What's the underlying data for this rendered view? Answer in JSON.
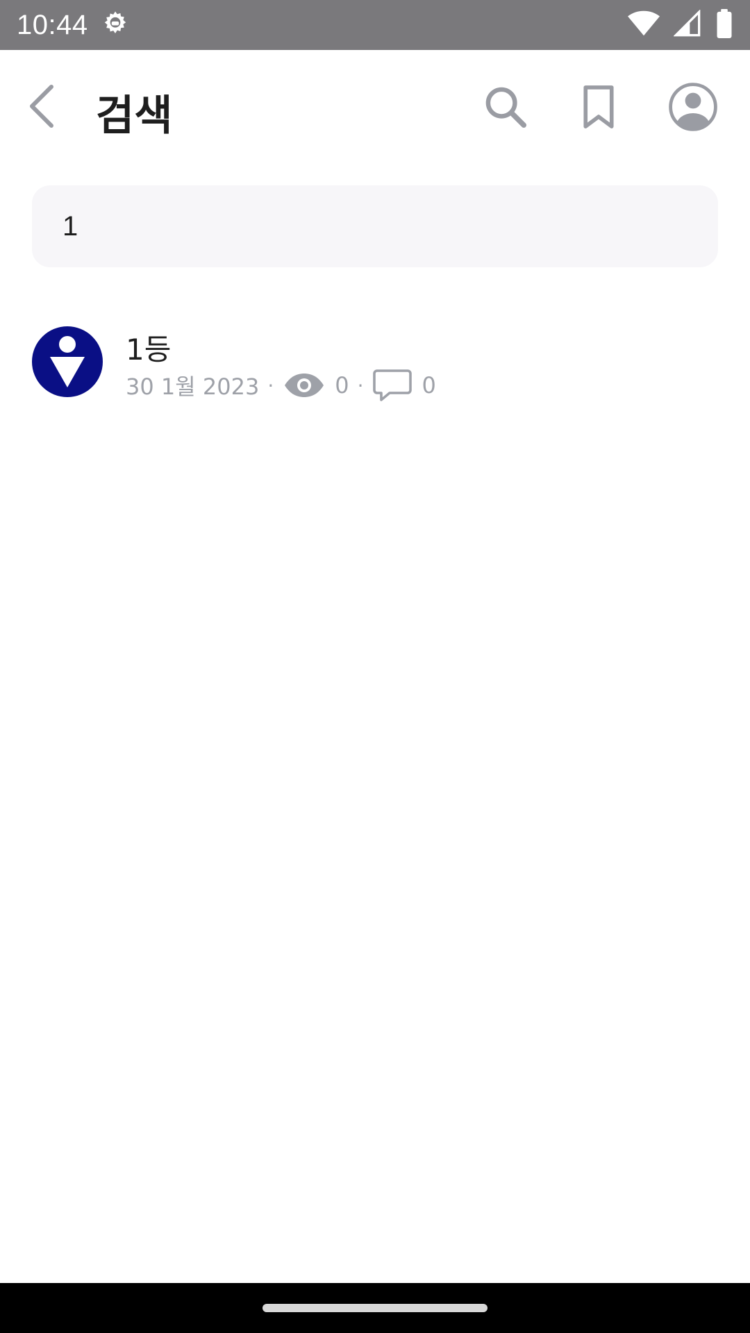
{
  "status_bar": {
    "time": "10:44",
    "icons": [
      "settings-gear-icon",
      "wifi-icon",
      "signal-icon",
      "battery-icon"
    ],
    "background": "#7a797c"
  },
  "app_bar": {
    "title": "검색",
    "icons": [
      "back-arrow-icon",
      "search-icon",
      "bookmark-icon",
      "account-icon"
    ]
  },
  "search": {
    "value": "1",
    "background": "#f7f6f9"
  },
  "results": [
    {
      "title": "1등",
      "date": "30 1월 2023",
      "separator": "·",
      "views": "0",
      "comments": "0",
      "avatar_color": "#0a0f85"
    }
  ],
  "colors": {
    "text_primary": "#1e1e1e",
    "text_secondary": "#9ea1a8",
    "icon": "#9a9ca3"
  }
}
